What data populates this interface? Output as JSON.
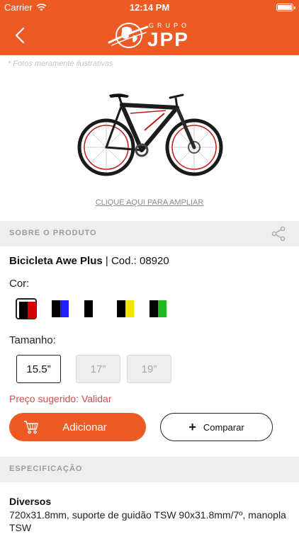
{
  "status_bar": {
    "carrier": "Carrier",
    "time": "12:14 PM"
  },
  "header": {
    "logo_top": "GRUPO",
    "logo_main": "JPP"
  },
  "image_note": "* Fotos meramente ilustrativas",
  "zoom_link": "CLIQUE AQUI PARA AMPLIAR",
  "about_section": {
    "title": "SOBRE O PRODUTO"
  },
  "product": {
    "name": "Bicicleta Awe Plus",
    "separator": " | ",
    "code": "Cod.: 08920"
  },
  "color": {
    "label": "Cor:",
    "swatches": [
      {
        "name": "black-red",
        "colors": [
          "#000000",
          "#d40000"
        ],
        "selected": true
      },
      {
        "name": "black-blue",
        "colors": [
          "#000000",
          "#1f1fff"
        ],
        "selected": false
      },
      {
        "name": "black-white",
        "colors": [
          "#000000",
          "#ffffff"
        ],
        "selected": false
      },
      {
        "name": "black-yellow",
        "colors": [
          "#000000",
          "#f5e400"
        ],
        "selected": false
      },
      {
        "name": "black-green",
        "colors": [
          "#000000",
          "#1fb81f"
        ],
        "selected": false
      }
    ]
  },
  "size": {
    "label": "Tamanho:",
    "options": [
      {
        "value": "15.5”",
        "state": "active"
      },
      {
        "value": "17”",
        "state": "disabled"
      },
      {
        "value": "19”",
        "state": "disabled"
      }
    ]
  },
  "price_link": "Preço sugerido: Validar",
  "actions": {
    "add_label": "Adicionar",
    "compare_label": "Comparar"
  },
  "spec_section": {
    "title": "ESPECIFICAÇÃO"
  },
  "specs": {
    "title": "Diversos",
    "body": "720x31.8mm, suporte de guidão TSW 90x31.8mm/7º, manopla TSW"
  },
  "colors": {
    "brand_orange": "#ee5a24",
    "section_bg": "#eeeeee",
    "price_red": "#d64b4b"
  }
}
